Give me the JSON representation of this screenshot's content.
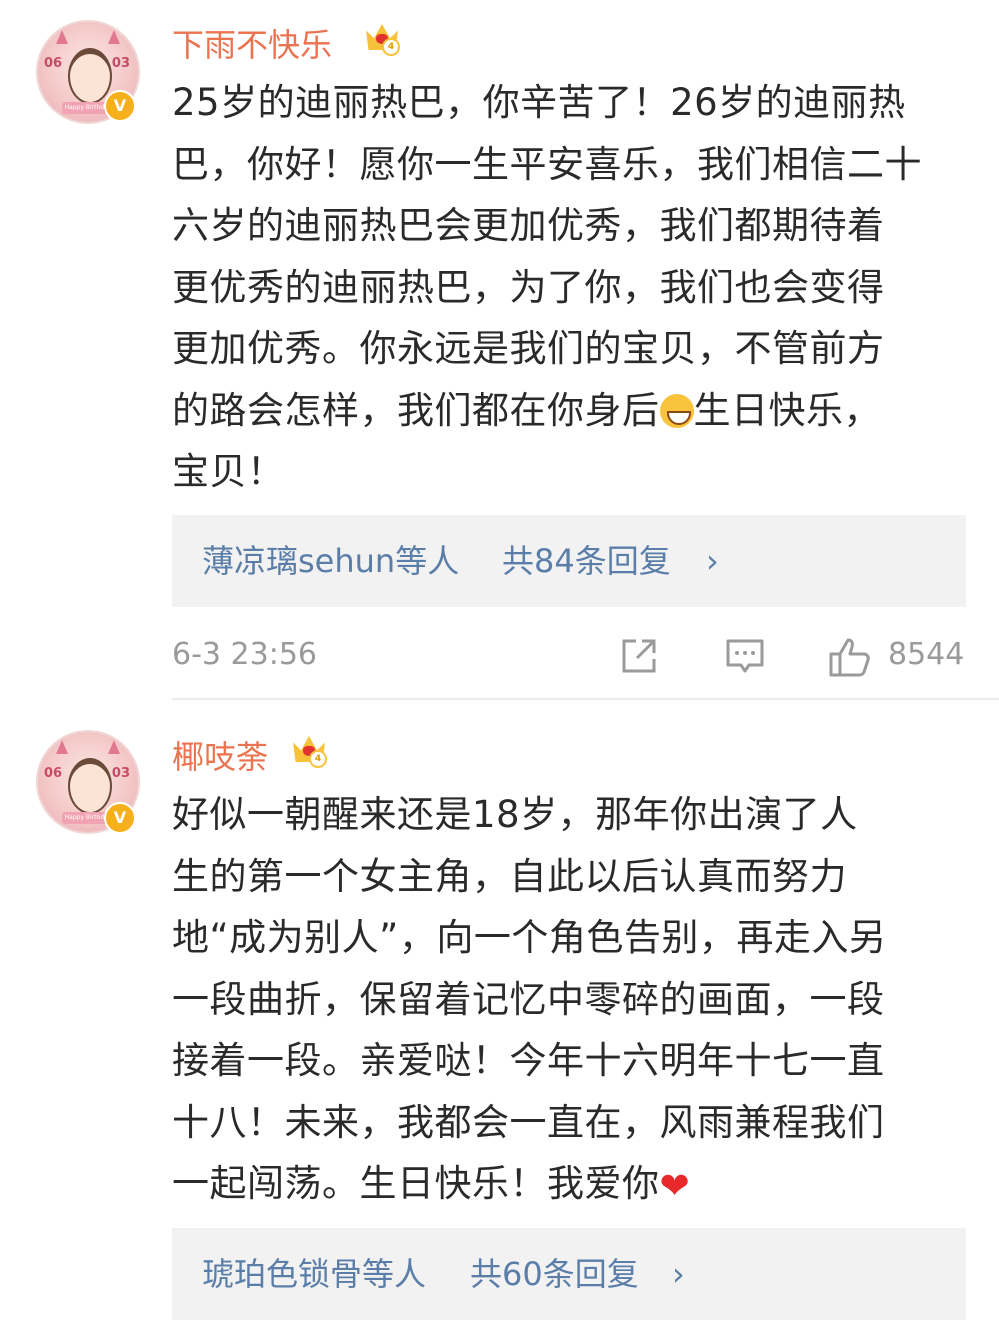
{
  "comments": [
    {
      "username": "下雨不快乐",
      "crown_level": "4",
      "avatar": {
        "left_num": "06",
        "right_num": "03",
        "ribbon": "Happy Birthday"
      },
      "verified_badge": "V",
      "text_lines": [
        "25岁的迪丽热巴，你辛苦了！26岁的迪丽热",
        "巴，你好！愿你一生平安喜乐，我们相信二十",
        "六岁的迪丽热巴会更加优秀，我们都期待着",
        "更优秀的迪丽热巴，为了你，我们也会变得",
        "更加优秀。你永远是我们的宝贝，不管前方",
        "的路会怎样，我们都在你身后",
        "宝贝！"
      ],
      "line6_suffix": "生日快乐，",
      "emoji": "laughing-face-icon",
      "reply_names": "薄凉璃sehun等人",
      "reply_count": "共84条回复",
      "reply_chevron": "›",
      "date": "6-3 23:56",
      "like_count": "8544"
    },
    {
      "username": "椰吱荼",
      "crown_level": "4",
      "avatar": {
        "left_num": "06",
        "right_num": "03",
        "ribbon": "Happy Birthday"
      },
      "verified_badge": "V",
      "text_lines": [
        "好似一朝醒来还是18岁，那年你出演了人",
        "生的第一个女主角，自此以后认真而努力",
        "地“成为别人”，向一个角色告别，再走入另",
        "一段曲折，保留着记忆中零碎的画面，一段",
        "接着一段。亲爱哒！今年十六明年十七一直",
        "十八！未来，我都会一直在，风雨兼程我们",
        "一起闯荡。生日快乐！我爱你"
      ],
      "emoji": "red-heart-icon",
      "heart_glyph": "❤",
      "reply_names": "琥珀色锁骨等人",
      "reply_count": "共60条回复",
      "reply_chevron": "›"
    }
  ],
  "colors": {
    "username": "#eb7350",
    "link": "#5a7ea8",
    "meta": "#9a9a9a",
    "reply_bg": "#f2f2f2"
  }
}
